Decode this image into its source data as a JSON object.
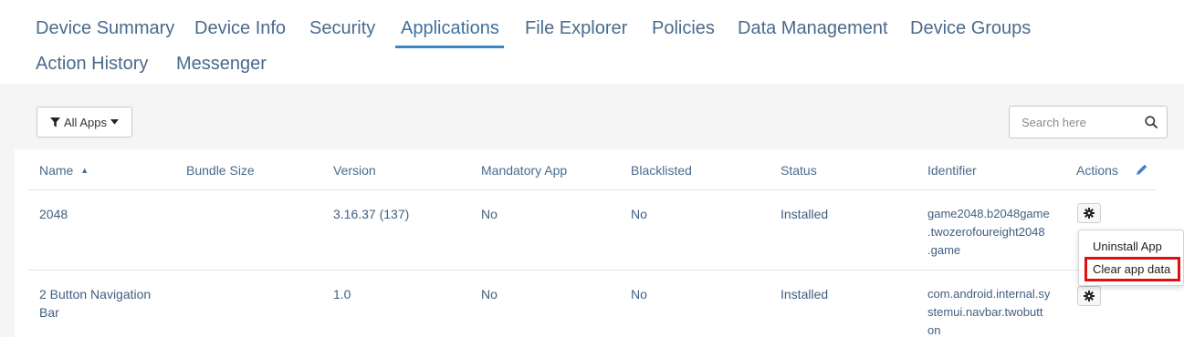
{
  "tabs": [
    {
      "label": "Device Summary"
    },
    {
      "label": "Device Info"
    },
    {
      "label": "Security"
    },
    {
      "label": "Applications",
      "active": true
    },
    {
      "label": "File Explorer"
    },
    {
      "label": "Policies"
    },
    {
      "label": "Data Management"
    },
    {
      "label": "Device Groups"
    },
    {
      "label": "Action History"
    },
    {
      "label": "Messenger"
    }
  ],
  "filter": {
    "label": "All Apps",
    "icon": "filter-icon"
  },
  "search": {
    "placeholder": "Search here",
    "icon": "search-icon"
  },
  "table": {
    "headers": [
      "Name",
      "Bundle Size",
      "Version",
      "Mandatory App",
      "Blacklisted",
      "Status",
      "Identifier",
      "Actions"
    ],
    "sort_indicator": "▲",
    "rows": [
      {
        "name": "2048",
        "bundle_size": "",
        "version": "3.16.37 (137)",
        "mandatory": "No",
        "blacklisted": "No",
        "status": "Installed",
        "identifier": "game2048.b2048game\n.twozerofoureight2048\n.game"
      },
      {
        "name": "2 Button Navigation\nBar",
        "bundle_size": "",
        "version": "1.0",
        "mandatory": "No",
        "blacklisted": "No",
        "status": "Installed",
        "identifier": "com.android.internal.sy\nstemui.navbar.twobutt\non"
      }
    ]
  },
  "actions_menu": {
    "items": [
      "Uninstall App",
      "Clear app data"
    ],
    "highlighted": "Clear app data"
  },
  "colors": {
    "accent": "#3d86c6",
    "highlight": "#e01010",
    "text": "#3f5f80"
  }
}
